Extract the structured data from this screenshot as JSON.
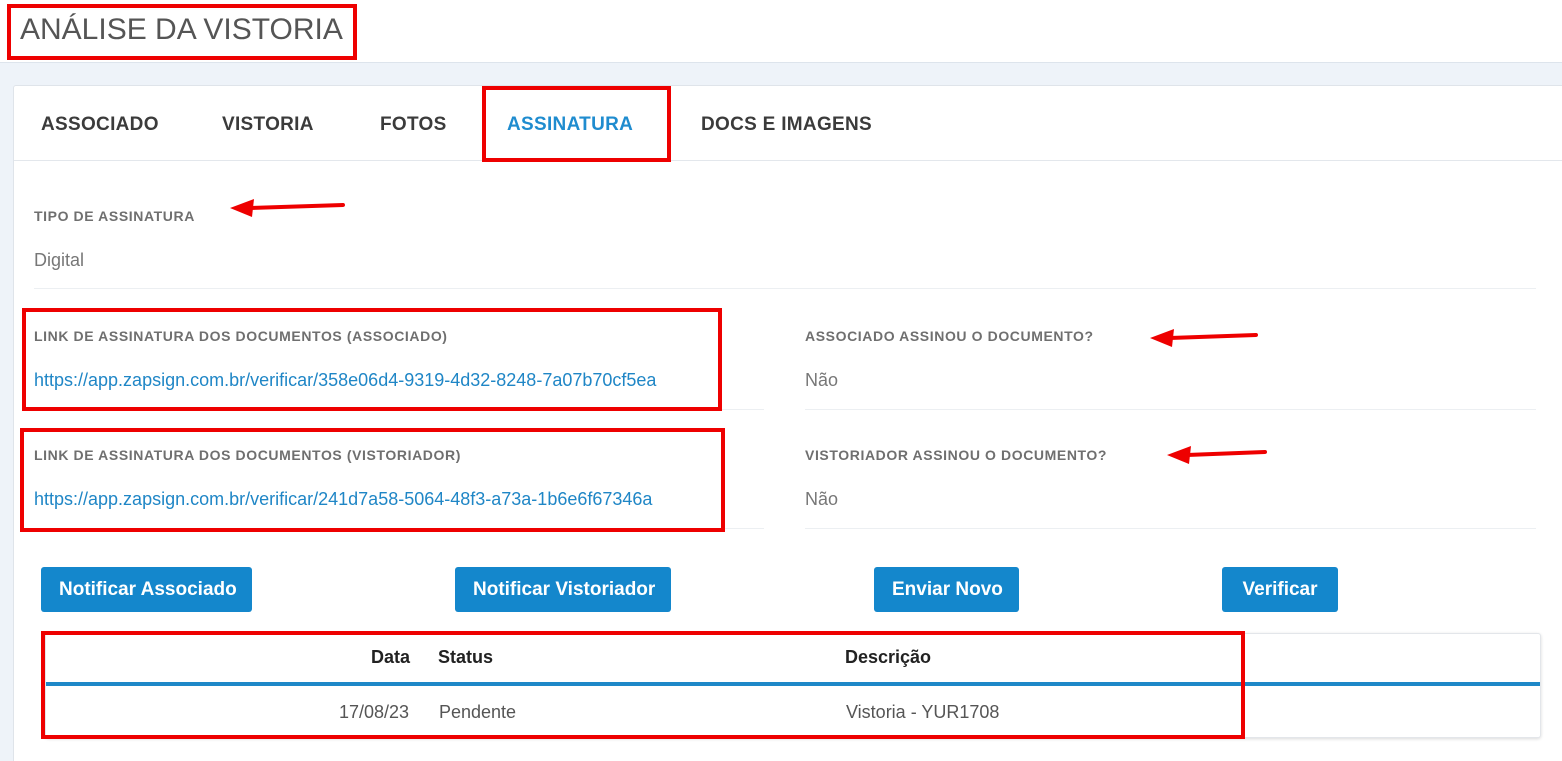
{
  "page": {
    "title": "ANÁLISE DA VISTORIA"
  },
  "tabs": [
    {
      "label": "ASSOCIADO"
    },
    {
      "label": "VISTORIA"
    },
    {
      "label": "FOTOS"
    },
    {
      "label": "ASSINATURA",
      "active": true
    },
    {
      "label": "DOCS E IMAGENS"
    }
  ],
  "signature": {
    "type_label": "TIPO DE ASSINATURA",
    "type_value": "Digital",
    "assoc_link_label": "LINK DE ASSINATURA DOS DOCUMENTOS (ASSOCIADO)",
    "assoc_link": "https://app.zapsign.com.br/verificar/358e06d4-9319-4d32-8248-7a07b70cf5ea",
    "assoc_signed_label": "ASSOCIADO ASSINOU O DOCUMENTO?",
    "assoc_signed_value": "Não",
    "insp_link_label": "LINK DE ASSINATURA DOS DOCUMENTOS (VISTORIADOR)",
    "insp_link": "https://app.zapsign.com.br/verificar/241d7a58-5064-48f3-a73a-1b6e6f67346a",
    "insp_signed_label": "VISTORIADOR ASSINOU O DOCUMENTO?",
    "insp_signed_value": "Não"
  },
  "buttons": {
    "notify_associate": "Notificar Associado",
    "notify_inspector": "Notificar Vistoriador",
    "send_new": "Enviar Novo",
    "verify": "Verificar"
  },
  "table": {
    "columns": [
      "Data",
      "Status",
      "Descrição"
    ],
    "rows": [
      {
        "date": "17/08/23",
        "status": "Pendente",
        "description": "Vistoria - YUR1708"
      }
    ]
  },
  "colors": {
    "accent": "#1487cc",
    "link": "#1f86c6",
    "annotation": "#ee0000"
  }
}
